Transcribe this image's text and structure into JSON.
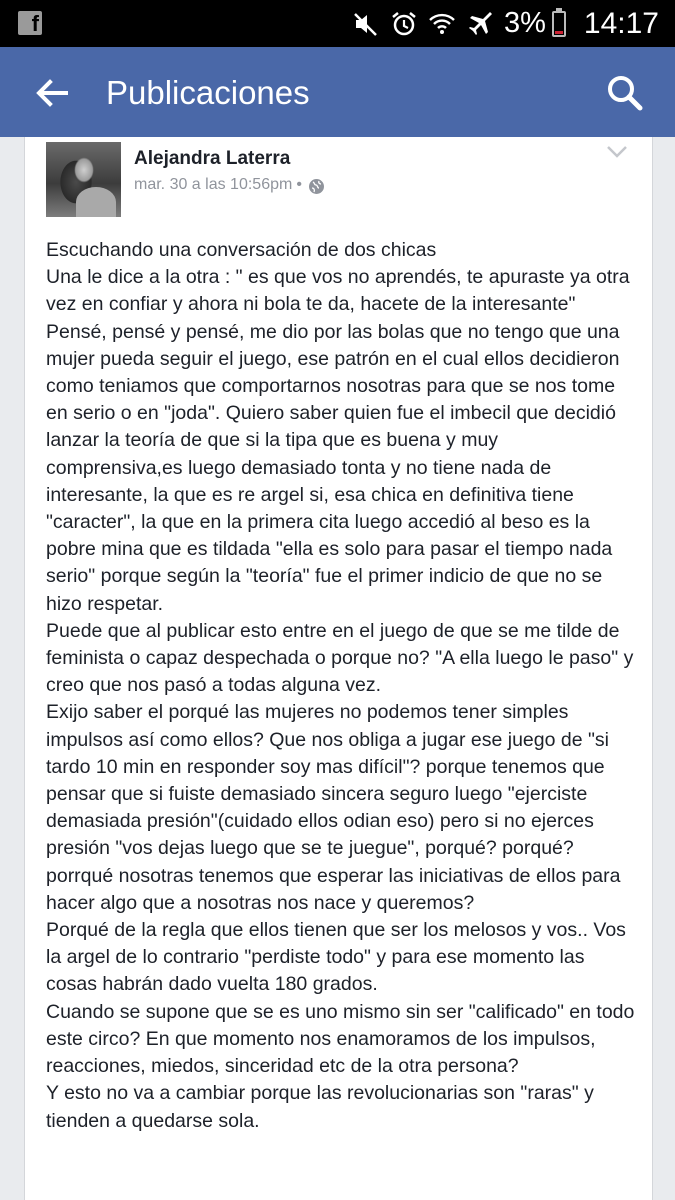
{
  "status_bar": {
    "battery_percent": "3%",
    "time": "14:17",
    "icons": [
      "facebook-notification-icon",
      "mute-icon",
      "alarm-icon",
      "wifi-icon",
      "airplane-icon",
      "battery-icon"
    ],
    "battery_fill_color": "#cc2233"
  },
  "app_bar": {
    "title": "Publicaciones",
    "background_color": "#4a68a8"
  },
  "post": {
    "author": "Alejandra Laterra",
    "timestamp": "mar. 30 a las 10:56pm",
    "separator": "•",
    "audience_icon": "globe-icon",
    "paragraphs": [
      "Escuchando una conversación de dos chicas",
      "Una le dice a la otra : \" es que vos no aprendés, te apuraste ya otra vez en confiar y ahora ni bola te da, hacete de la interesante\"",
      "Pensé, pensé y pensé, me dio por las bolas que no tengo que una mujer pueda seguir el juego, ese patrón en el cual ellos decidieron como teniamos que comportarnos nosotras para que se nos tome en serio o en \"joda\". Quiero saber quien fue el imbecil que decidió lanzar la teoría de que si la tipa que es buena y muy comprensiva,es luego demasiado tonta y no tiene nada de interesante, la que es re argel si, esa chica en definitiva tiene \"caracter\", la que en la primera cita luego accedió al beso es la pobre mina que es tildada \"ella es solo para pasar el tiempo nada serio\" porque según la \"teoría\" fue el primer indicio de que no se hizo respetar.",
      "Puede que al publicar esto entre en el juego de que se me tilde de feminista o capaz despechada o porque no? \"A ella luego le paso\" y creo que nos pasó a todas alguna vez.",
      "Exijo saber el porqué las mujeres no podemos tener simples impulsos así como ellos? Que nos obliga a jugar ese juego de \"si tardo 10 min en responder soy mas difícil\"? porque tenemos que pensar que si fuiste demasiado sincera seguro luego \"ejerciste demasiada presión\"(cuidado ellos odian eso) pero si no ejerces presión \"vos dejas luego que se te juegue\", porqué? porqué?porrqué nosotras tenemos que esperar las iniciativas de ellos para hacer algo que a nosotras nos nace y queremos?",
      "Porqué de la regla que ellos tienen que ser los melosos y vos.. Vos la argel de lo contrario \"perdiste todo\" y para ese momento las cosas habrán dado vuelta 180 grados.",
      "Cuando se supone que se es uno mismo sin ser \"calificado\" en todo este circo? En que momento nos enamoramos de los impulsos, reacciones, miedos, sinceridad etc de la otra persona?",
      "Y esto no va a cambiar porque las revolucionarias son \"raras\" y tienden a quedarse sola."
    ]
  }
}
